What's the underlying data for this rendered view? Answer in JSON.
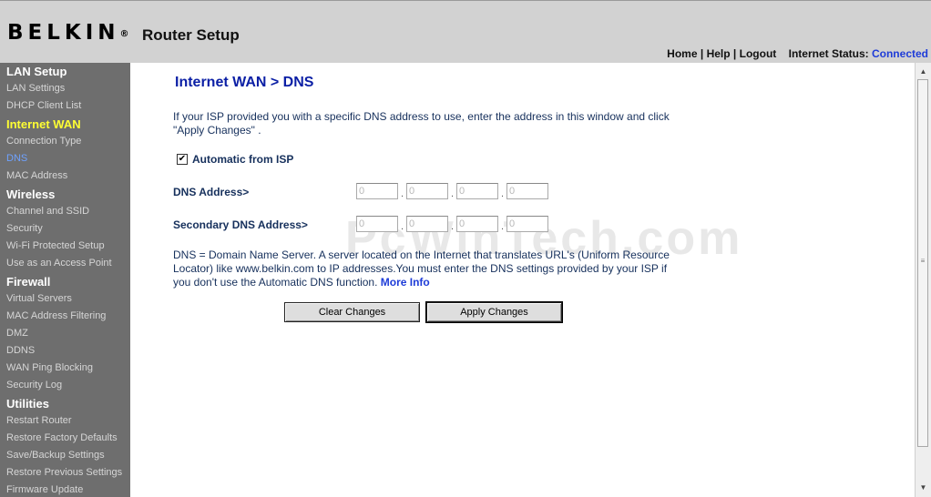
{
  "header": {
    "logo_text": "BELKIN",
    "logo_mark": "®",
    "app_title": "Router Setup",
    "links": {
      "home": "Home",
      "help": "Help",
      "logout": "Logout",
      "sep": "|"
    },
    "status_label": "Internet Status:",
    "status_value": "Connected"
  },
  "sidebar": {
    "sections": [
      {
        "title": "LAN Setup",
        "items": [
          "LAN Settings",
          "DHCP Client List"
        ]
      },
      {
        "title": "Internet WAN",
        "items": [
          "Connection Type",
          "DNS",
          "MAC Address"
        ]
      },
      {
        "title": "Wireless",
        "items": [
          "Channel and SSID",
          "Security",
          "Wi-Fi Protected Setup",
          "Use as an Access Point"
        ]
      },
      {
        "title": "Firewall",
        "items": [
          "Virtual Servers",
          "MAC Address Filtering",
          "DMZ",
          "DDNS",
          "WAN Ping Blocking",
          "Security Log"
        ]
      },
      {
        "title": "Utilities",
        "items": [
          "Restart Router",
          "Restore Factory Defaults",
          "Save/Backup Settings",
          "Restore Previous Settings",
          "Firmware Update"
        ]
      }
    ],
    "active_section": "Internet WAN",
    "active_item": "DNS"
  },
  "main": {
    "title": "Internet WAN > DNS",
    "intro": "If your ISP provided you with a specific DNS address to use, enter the address in this window and click \"Apply Changes\" .",
    "auto_checked": true,
    "auto_check_glyph": "✔",
    "auto_label": "Automatic from ISP",
    "dns_label": "DNS Address>",
    "dns_octets": [
      "0",
      "0",
      "0",
      "0"
    ],
    "secondary_label": "Secondary DNS Address>",
    "secondary_octets": [
      "0",
      "0",
      "0",
      "0"
    ],
    "octet_separator": ".",
    "info": "DNS = Domain Name Server. A server located on the Internet that translates URL's (Uniform Resource Locator) like www.belkin.com to IP addresses.You must enter the DNS settings provided by your ISP if you don't use the Automatic DNS function.",
    "more_info": "More Info",
    "clear_button": "Clear Changes",
    "apply_button": "Apply Changes"
  },
  "watermark": "PcWinTech.com",
  "scrollbar": {
    "up_icon": "▲",
    "down_icon": "▼",
    "grip_icon": "≡"
  },
  "colors": {
    "sidebar_bg": "#6e6e6e",
    "header_bg": "#d2d2d2",
    "title_blue": "#0b1fa5",
    "active_section": "#ffff33",
    "active_item": "#6ea2ff",
    "link_blue": "#1e3cd8"
  }
}
